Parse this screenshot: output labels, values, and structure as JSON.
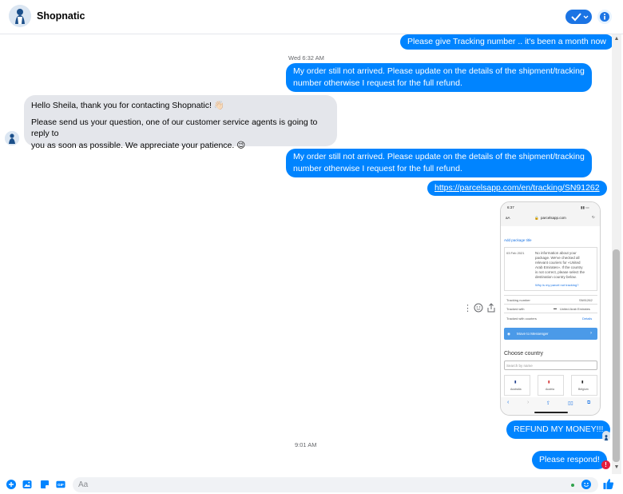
{
  "header": {
    "contact_name": "Shopnatic"
  },
  "messages": {
    "m1": "Please give Tracking number .. it's been a month now",
    "ts1": "Wed 6:32 AM",
    "m2_line1": "My order still not arrived. Please update on the details of the shipment/tracking",
    "m2_line2": "number otherwise I request for the full refund.",
    "in1_line1": "Hello Sheila, thank you for contacting Shopnatic! 👋🏻",
    "in1_line2": "Please send us your question, one of our customer service agents is going to reply to",
    "in1_line3": "you as soon as possible. We appreciate your patience. 😉",
    "m3_line1": "My order still not arrived. Please update on the details of the shipment/tracking",
    "m3_line2": "number otherwise I request for the full refund.",
    "link": "https://parcelsapp.com/en/tracking/SN91262",
    "m4": "REFUND MY MONEY!!!",
    "ts2": "9:01 AM",
    "m5": "Please respond!"
  },
  "screenshot": {
    "time": "6:37",
    "url": "parcelsapp.com",
    "aa": "aA",
    "add_package_title": "Add package title",
    "date": "03 Feb 2021",
    "info_l1": "No information about your",
    "info_l2": "package. We've checked all",
    "info_l3": "relevant couriers for «United",
    "info_l4": "Arab Emirates». If the country",
    "info_l5": "is not correct, please select the",
    "info_l6": "destination country below.",
    "why_link": "Why is my parcel not tracking?",
    "tracking_label": "Tracking number",
    "tracking_value": "SN91262",
    "tracked_with_label": "Tracked with",
    "tracked_with_value": "United Arab Emirates",
    "tracked_couriers_label": "Tracked with couriers",
    "tracked_couriers_value": "Details",
    "messenger_btn": "Move to Messenger",
    "choose_country": "Choose country",
    "search_placeholder": "Search by name",
    "country1": "Australia",
    "country2": "Austria",
    "country3": "Belgium"
  },
  "composer": {
    "placeholder": "Aa"
  },
  "colors": {
    "outgoing": "#0084ff",
    "incoming": "#e4e6eb",
    "accent": "#1b74e4",
    "error": "#e41e3f"
  },
  "icons": [
    "check-icon",
    "chevron-down-icon",
    "info-icon",
    "plus-icon",
    "image-icon",
    "sticker-icon",
    "gif-icon",
    "emoji-icon",
    "thumbs-up-icon",
    "more-icon",
    "react-icon",
    "share-icon",
    "error-icon"
  ]
}
